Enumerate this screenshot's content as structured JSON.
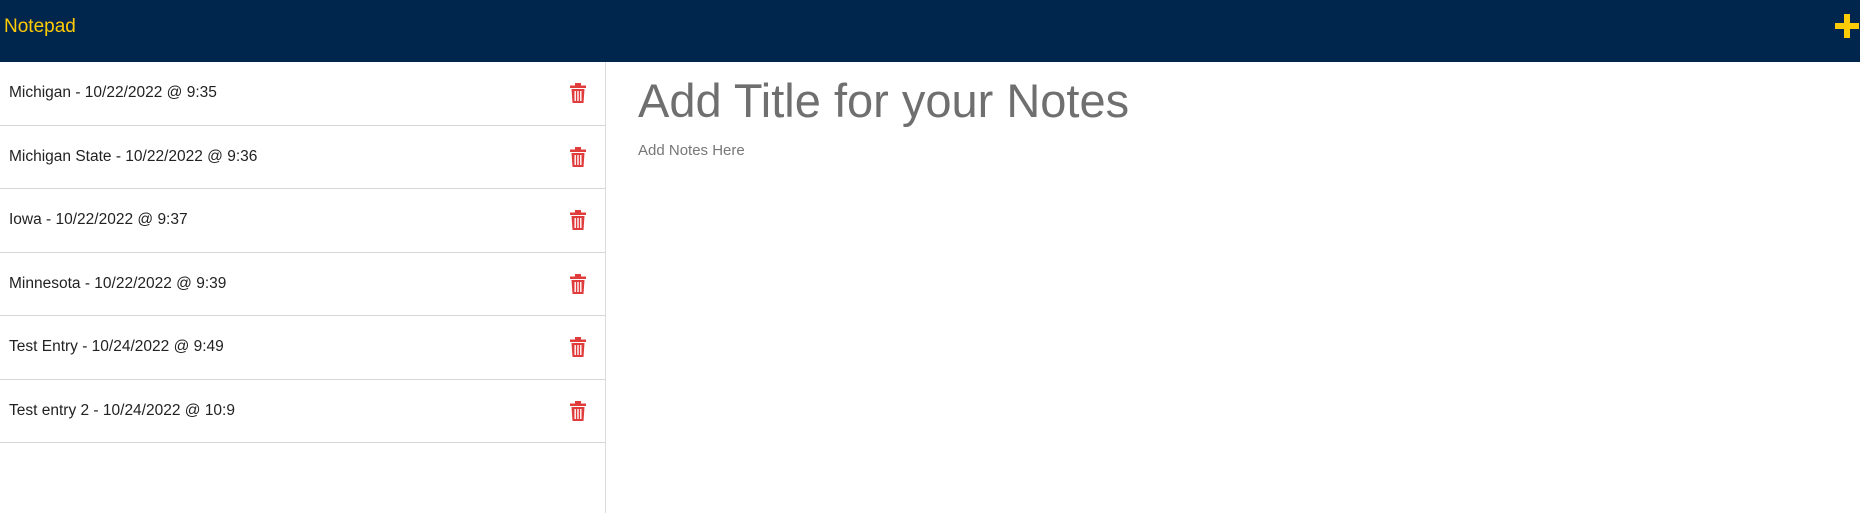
{
  "header": {
    "brand": "Notepad",
    "add_icon": "plus-icon"
  },
  "sidebar": {
    "delete_icon": "trash-icon",
    "notes": [
      {
        "title": "Michigan - 10/22/2022 @ 9:35"
      },
      {
        "title": "Michigan State - 10/22/2022 @ 9:36"
      },
      {
        "title": "Iowa - 10/22/2022 @ 9:37"
      },
      {
        "title": "Minnesota - 10/22/2022 @ 9:39"
      },
      {
        "title": "Test Entry - 10/24/2022 @ 9:49"
      },
      {
        "title": "Test entry 2 - 10/24/2022 @ 10:9"
      }
    ]
  },
  "editor": {
    "title_placeholder": "Add Title for your Notes",
    "notes_placeholder": "Add Notes Here"
  },
  "colors": {
    "navbar": "#00264d",
    "brand": "#ffcb05",
    "delete": "#e03c3c"
  }
}
